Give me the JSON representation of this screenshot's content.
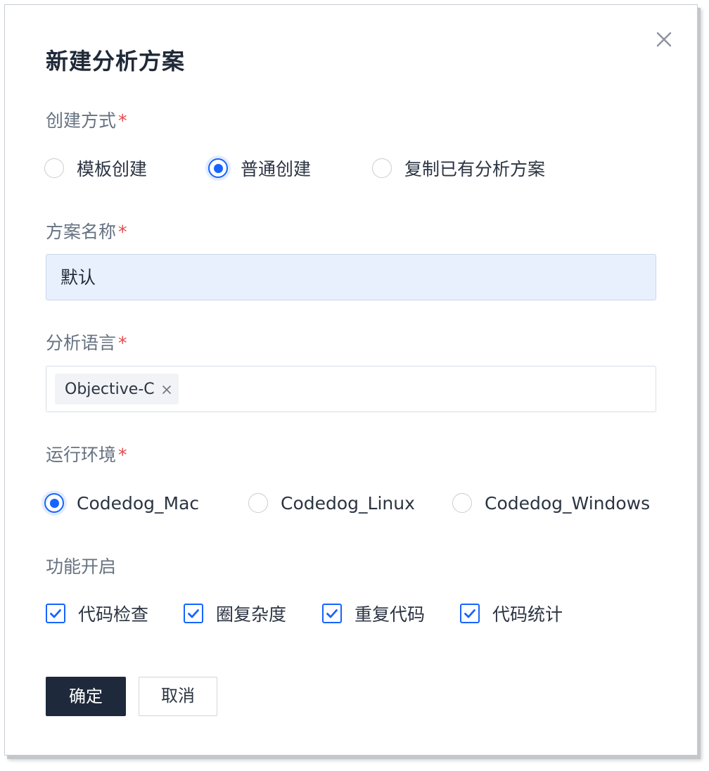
{
  "dialog": {
    "title": "新建分析方案",
    "close_icon": "close-icon"
  },
  "create_mode": {
    "label": "创建方式",
    "required_mark": "*",
    "options": [
      {
        "label": "模板创建",
        "selected": false
      },
      {
        "label": "普通创建",
        "selected": true
      },
      {
        "label": "复制已有分析方案",
        "selected": false
      }
    ]
  },
  "scheme_name": {
    "label": "方案名称",
    "required_mark": "*",
    "value": "默认"
  },
  "language": {
    "label": "分析语言",
    "required_mark": "*",
    "tags": [
      {
        "label": "Objective-C",
        "remove_icon": "close-icon"
      }
    ]
  },
  "environment": {
    "label": "运行环境",
    "required_mark": "*",
    "options": [
      {
        "label": "Codedog_Mac",
        "selected": true
      },
      {
        "label": "Codedog_Linux",
        "selected": false
      },
      {
        "label": "Codedog_Windows",
        "selected": false
      }
    ]
  },
  "features": {
    "label": "功能开启",
    "items": [
      {
        "label": "代码检查",
        "checked": true
      },
      {
        "label": "圈复杂度",
        "checked": true
      },
      {
        "label": "重复代码",
        "checked": true
      },
      {
        "label": "代码统计",
        "checked": true
      }
    ]
  },
  "actions": {
    "confirm_label": "确定",
    "cancel_label": "取消"
  },
  "colors": {
    "accent": "#1664ff",
    "primary_button": "#1e293b",
    "required": "#e5484d",
    "input_filled_bg": "#e9f0fd"
  }
}
